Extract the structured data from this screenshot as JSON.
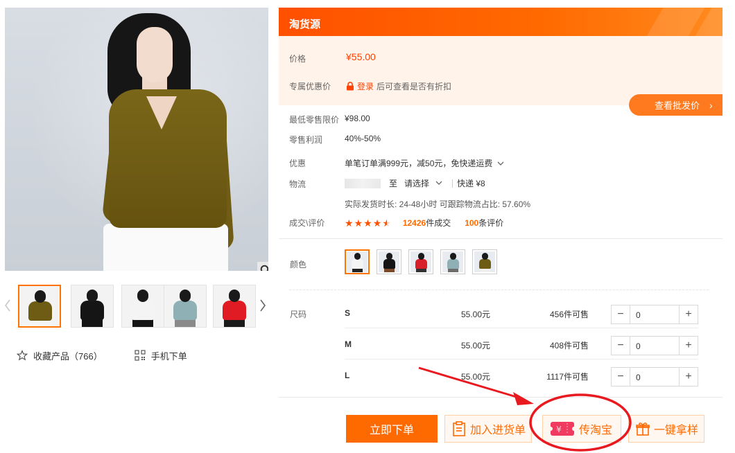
{
  "gallery": {
    "thumbnails": [
      {
        "name": "thumb-olive-sweater",
        "color": "#6e5b14",
        "legs": "#f5f5f5"
      },
      {
        "name": "thumb-black-sweater",
        "color": "#151515",
        "legs": "#151515"
      },
      {
        "name": "thumb-white-sweater",
        "color": "#f4f4f4",
        "legs": "#151515"
      },
      {
        "name": "thumb-blue-sweater",
        "color": "#8fb1b6",
        "legs": "#8a8a8a"
      },
      {
        "name": "thumb-red-sweater",
        "color": "#e01b23",
        "legs": "#1a1a1a"
      }
    ],
    "favorite_label": "收藏产品（766）",
    "mobile_order_label": "手机下单"
  },
  "source": {
    "title": "淘货源"
  },
  "pricing": {
    "price_label": "价格",
    "price_value": "¥55.00",
    "member_price_label": "专属优惠价",
    "login_link": "登录",
    "login_suffix": "后可查看是否有折扣",
    "wholesale_button": "查看批发价",
    "wholesale_chevron": "›"
  },
  "details": {
    "min_retail_label": "最低零售限价",
    "min_retail_value": "¥98.00",
    "profit_label": "零售利润",
    "profit_value": "40%-50%",
    "discount_label": "优惠",
    "discount_value": "单笔订单满999元，减50元，免快递运费",
    "logistics_label": "物流",
    "logistics_to": "至",
    "logistics_select": "请选择",
    "logistics_express": "快递 ¥8",
    "shipping_info": "实际发货时长: 24-48小时   可跟踪物流占比: 57.60%",
    "rating_label": "成交\\评价",
    "rating_stars": 4.5,
    "deals_count": "12426",
    "deals_suffix": "件成交",
    "reviews_count": "100",
    "reviews_suffix": "条评价"
  },
  "color": {
    "label": "颜色",
    "swatches": [
      {
        "body": "#f4f4f4",
        "legs": "#222222",
        "active": true
      },
      {
        "body": "#151515",
        "legs": "#7a4a2a",
        "active": false
      },
      {
        "body": "#d9202a",
        "legs": "#333333",
        "active": false
      },
      {
        "body": "#8fb1b6",
        "legs": "#6d6d6d",
        "active": false
      },
      {
        "body": "#6e5b14",
        "legs": "#f0f0f0",
        "active": false
      }
    ]
  },
  "sizes": {
    "label": "尺码",
    "rows": [
      {
        "name": "S",
        "price": "55.00元",
        "stock": "456件可售",
        "qty": "0"
      },
      {
        "name": "M",
        "price": "55.00元",
        "stock": "408件可售",
        "qty": "0"
      },
      {
        "name": "L",
        "price": "55.00元",
        "stock": "1117件可售",
        "qty": "0"
      }
    ]
  },
  "actions": {
    "order_now": "立即下单",
    "add_to_cart": "加入进货单",
    "push_taobao": "传淘宝",
    "one_click_sample": "一键拿样"
  },
  "colors": {
    "accent": "#ff6a00",
    "price_red": "#ff4200",
    "annotation_red": "#e8191f"
  }
}
